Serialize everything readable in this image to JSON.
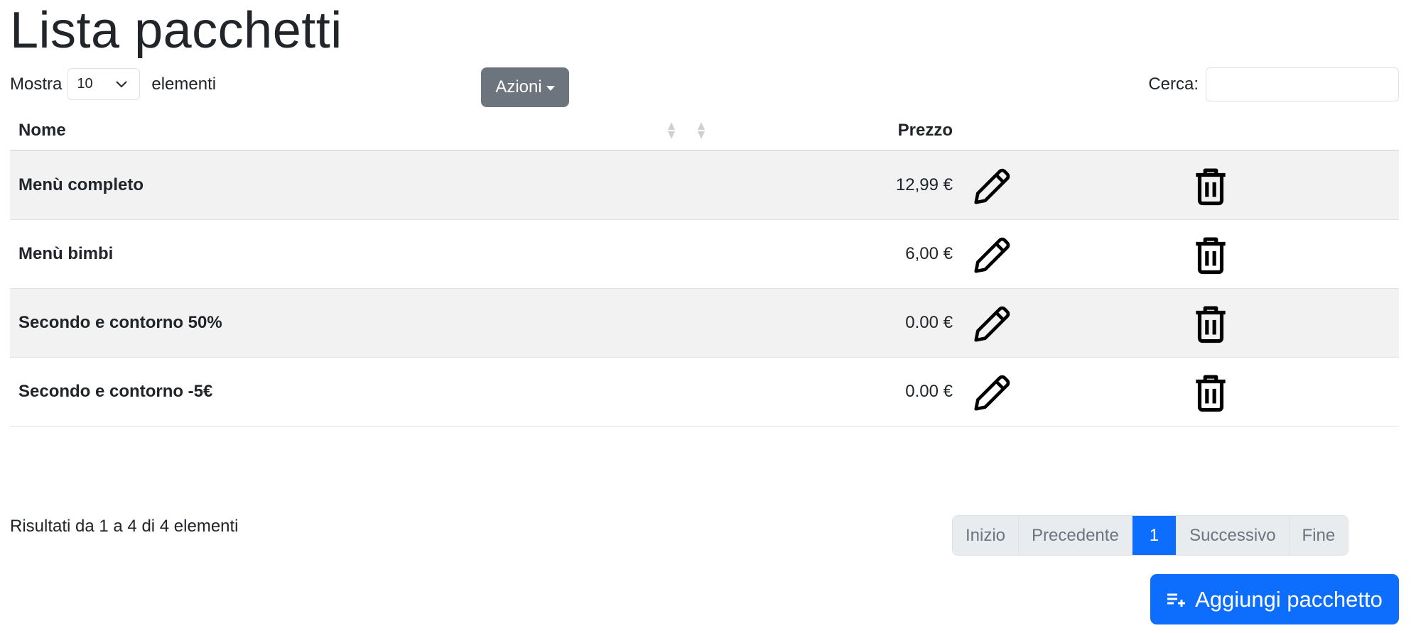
{
  "page": {
    "title": "Lista pacchetti"
  },
  "length": {
    "prefix": "Mostra",
    "selected": "10",
    "suffix": "elementi"
  },
  "actions": {
    "label": "Azioni"
  },
  "search": {
    "label": "Cerca:",
    "value": "",
    "placeholder": ""
  },
  "table": {
    "headers": {
      "name": "Nome",
      "price": "Prezzo"
    },
    "rows": [
      {
        "name": "Menù completo",
        "price": "12,99 €"
      },
      {
        "name": "Menù bimbi",
        "price": "6,00 €"
      },
      {
        "name": "Secondo e contorno 50%",
        "price": "0.00 €"
      },
      {
        "name": "Secondo e contorno -5€",
        "price": "0.00 €"
      }
    ]
  },
  "info": {
    "text": "Risultati da 1 a 4 di 4 elementi"
  },
  "pagination": {
    "first": "Inizio",
    "prev": "Precedente",
    "current": "1",
    "next": "Successivo",
    "last": "Fine"
  },
  "add_button": {
    "label": "Aggiungi pacchetto"
  },
  "icons": {
    "edit": "pencil-icon",
    "delete": "trash-icon",
    "sort": "sort-icon",
    "add": "playlist-add-icon",
    "select": "chevron-down-icon",
    "dropdown": "caret-down-icon"
  },
  "colors": {
    "primary": "#0d6efd",
    "secondary": "#6c757d",
    "stripe": "#f2f2f2",
    "border": "#dee2e6",
    "pagination_bg": "#e9ecef"
  }
}
